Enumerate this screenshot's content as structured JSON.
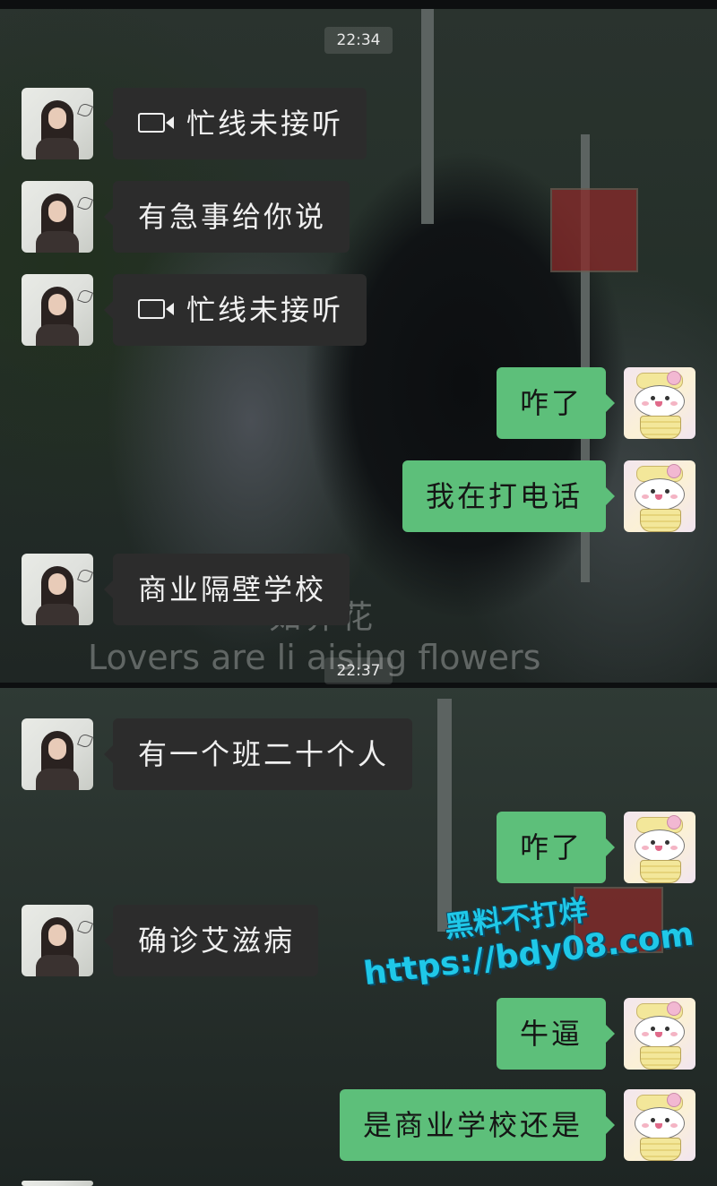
{
  "timestamps": [
    "22:34",
    "22:37"
  ],
  "messages": [
    {
      "side": "left",
      "type": "video_call",
      "text": "忙线未接听"
    },
    {
      "side": "left",
      "type": "text",
      "text": "有急事给你说"
    },
    {
      "side": "left",
      "type": "video_call",
      "text": "忙线未接听"
    },
    {
      "side": "right",
      "type": "text",
      "text": "咋了"
    },
    {
      "side": "right",
      "type": "text",
      "text": "我在打电话"
    },
    {
      "side": "left",
      "type": "text",
      "text": "商业隔壁学校"
    },
    {
      "side": "left",
      "type": "text",
      "text": "有一个班二十个人"
    },
    {
      "side": "right",
      "type": "text",
      "text": "咋了"
    },
    {
      "side": "left",
      "type": "text",
      "text": "确诊艾滋病"
    },
    {
      "side": "right",
      "type": "text",
      "text": "牛逼"
    },
    {
      "side": "right",
      "type": "text",
      "text": "是商业学校还是"
    }
  ],
  "background_subtitle": {
    "cn": "如养花",
    "en": "Lovers are li   aising flowers"
  },
  "watermark": {
    "line1": "黑料不打烊",
    "line2": "https://bdy08.com"
  },
  "colors": {
    "incoming_bubble": "#2c2c2c",
    "outgoing_bubble": "#5dbf7a",
    "watermark": "#1fc8e8"
  },
  "icons": {
    "video_call": "video-camera-icon"
  }
}
